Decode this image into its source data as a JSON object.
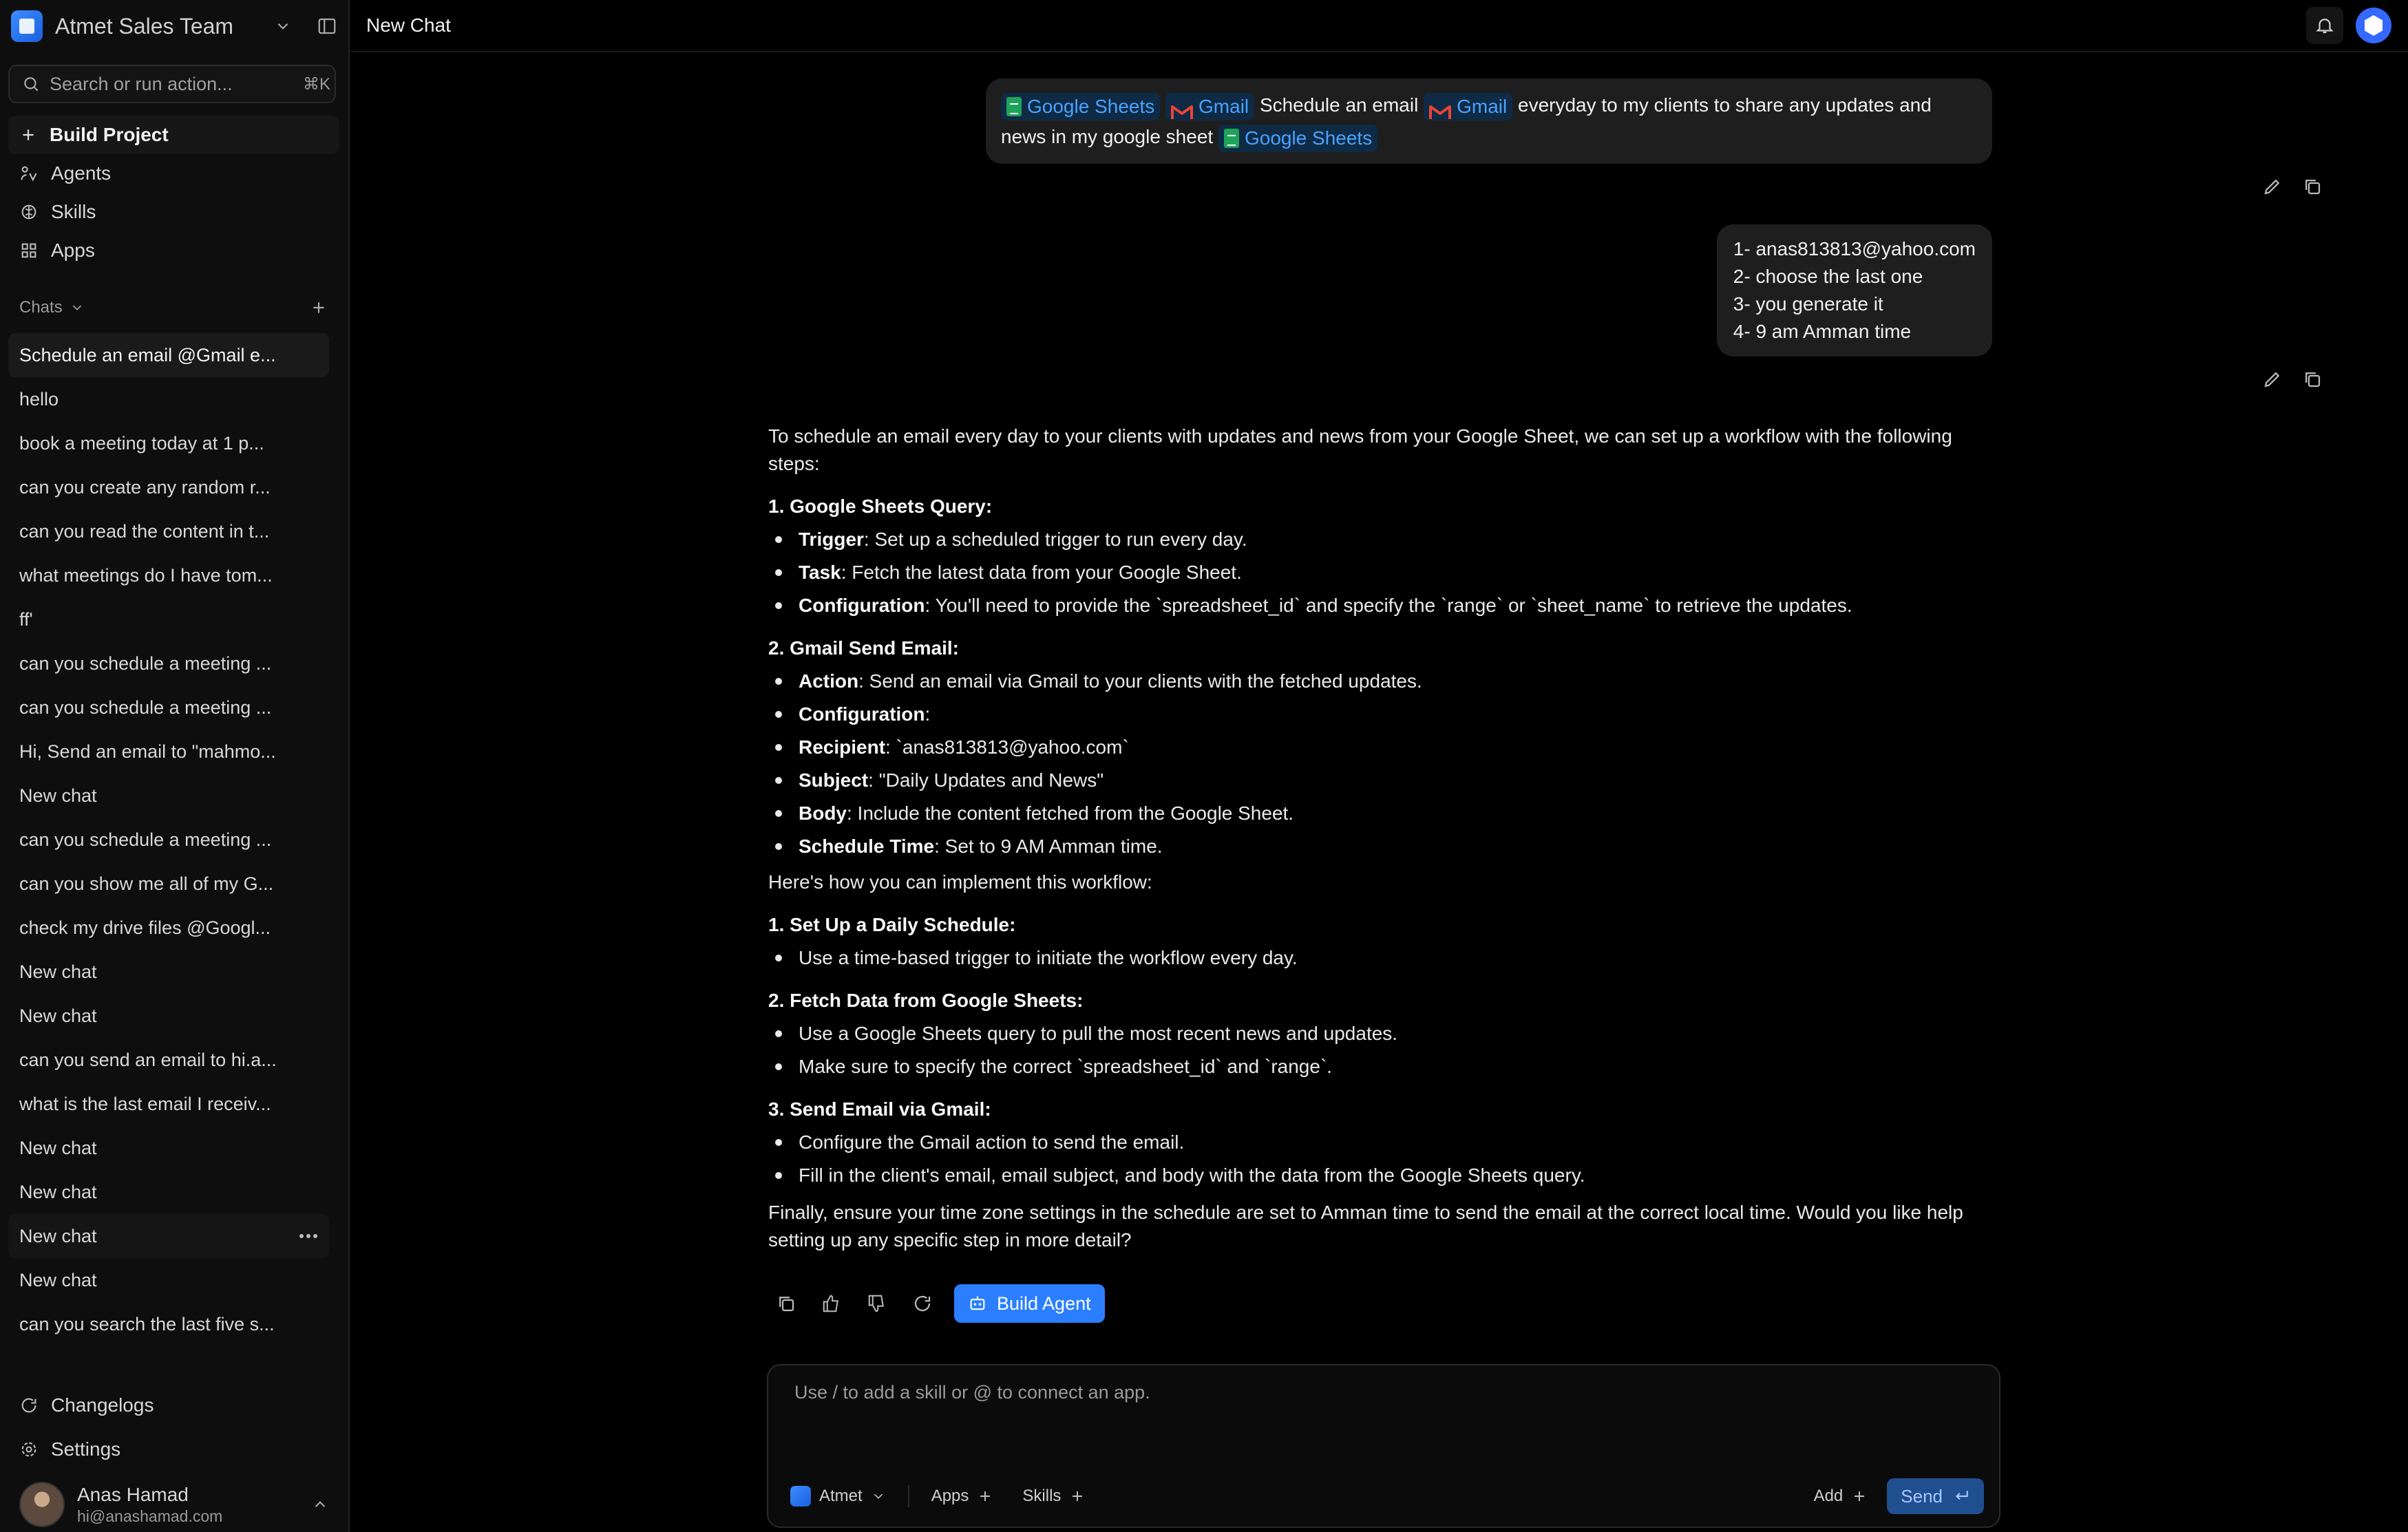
{
  "workspace": {
    "name": "Atmet Sales Team"
  },
  "search": {
    "placeholder": "Search or run action...",
    "shortcut": "⌘K"
  },
  "nav": {
    "build_project": "Build Project",
    "agents": "Agents",
    "skills": "Skills",
    "apps": "Apps"
  },
  "chats": {
    "label": "Chats",
    "items": [
      "Schedule an email @Gmail e...",
      "hello",
      "book a meeting today at 1 p...",
      "can you create any random r...",
      "can you read the content in t...",
      "what meetings do I have tom...",
      "ff'",
      "can you schedule a meeting ...",
      "can you schedule a meeting ...",
      "Hi, Send an email to \"mahmo...",
      "New chat",
      "can you schedule a meeting ...",
      "can you show me all of my G...",
      "check my drive files @Googl...",
      "New chat",
      "New chat",
      "can you send an email to hi.a...",
      "what is the last email I receiv...",
      "New chat",
      "New chat",
      "New chat",
      "New chat",
      "can you search the last five s..."
    ]
  },
  "bottom_nav": {
    "changelogs": "Changelogs",
    "settings": "Settings"
  },
  "user": {
    "name": "Anas Hamad",
    "email": "hi@anashamad.com"
  },
  "topbar": {
    "title": "New Chat"
  },
  "messages": {
    "user1": {
      "chip_sheets": "Google Sheets",
      "chip_gmail": "Gmail",
      "text_a": "Schedule an email",
      "text_b": "everyday to my clients to share any updates and news in my google sheet"
    },
    "user2": {
      "text": "1- anas813813@yahoo.com\n2- choose the last one\n3- you generate it\n4- 9 am Amman time"
    },
    "reply": {
      "intro": "To schedule an email every day to your clients with updates and news from your Google Sheet, we can set up a workflow with the following steps:",
      "s1": "1. Google Sheets Query:",
      "s1_items": [
        {
          "k": "Trigger",
          "v": ": Set up a scheduled trigger to run every day."
        },
        {
          "k": "Task",
          "v": ": Fetch the latest data from your Google Sheet."
        },
        {
          "k": "Configuration",
          "v": ": You'll need to provide the `spreadsheet_id` and specify the `range` or `sheet_name` to retrieve the updates."
        }
      ],
      "s2": "2. Gmail Send Email:",
      "s2_items": [
        {
          "k": "Action",
          "v": ": Send an email via Gmail to your clients with the fetched updates."
        },
        {
          "k": "Configuration",
          "v": ":"
        },
        {
          "k": "Recipient",
          "v": ": `anas813813@yahoo.com`"
        },
        {
          "k": "Subject",
          "v": ": \"Daily Updates and News\""
        },
        {
          "k": "Body",
          "v": ": Include the content fetched from the Google Sheet."
        },
        {
          "k": "Schedule Time",
          "v": ": Set to 9 AM Amman time."
        }
      ],
      "implement": "Here's how you can implement this workflow:",
      "t1": "1. Set Up a Daily Schedule:",
      "t1_items": [
        "Use a time-based trigger to initiate the workflow every day."
      ],
      "t2": "2. Fetch Data from Google Sheets:",
      "t2_items": [
        "Use a Google Sheets query to pull the most recent news and updates.",
        "Make sure to specify the correct `spreadsheet_id` and `range`."
      ],
      "t3": "3. Send Email via Gmail:",
      "t3_items": [
        "Configure the Gmail action to send the email.",
        "Fill in the client's email, email subject, and body with the data from the Google Sheets query."
      ],
      "outro": "Finally, ensure your time zone settings in the schedule are set to Amman time to send the email at the correct local time. Would you like help setting up any specific step in more detail?",
      "build_agent": "Build Agent"
    }
  },
  "composer": {
    "placeholder": "Use / to add a skill or @ to connect an app.",
    "model": "Atmet",
    "apps": "Apps",
    "skills": "Skills",
    "add": "Add",
    "send": "Send"
  },
  "colors": {
    "accent": "#2b7fff",
    "chip_bg": "#0e2a45",
    "chip_text": "#4aa3ff",
    "sheets_green": "#1da35a",
    "gmail_red": "#ea4335"
  }
}
